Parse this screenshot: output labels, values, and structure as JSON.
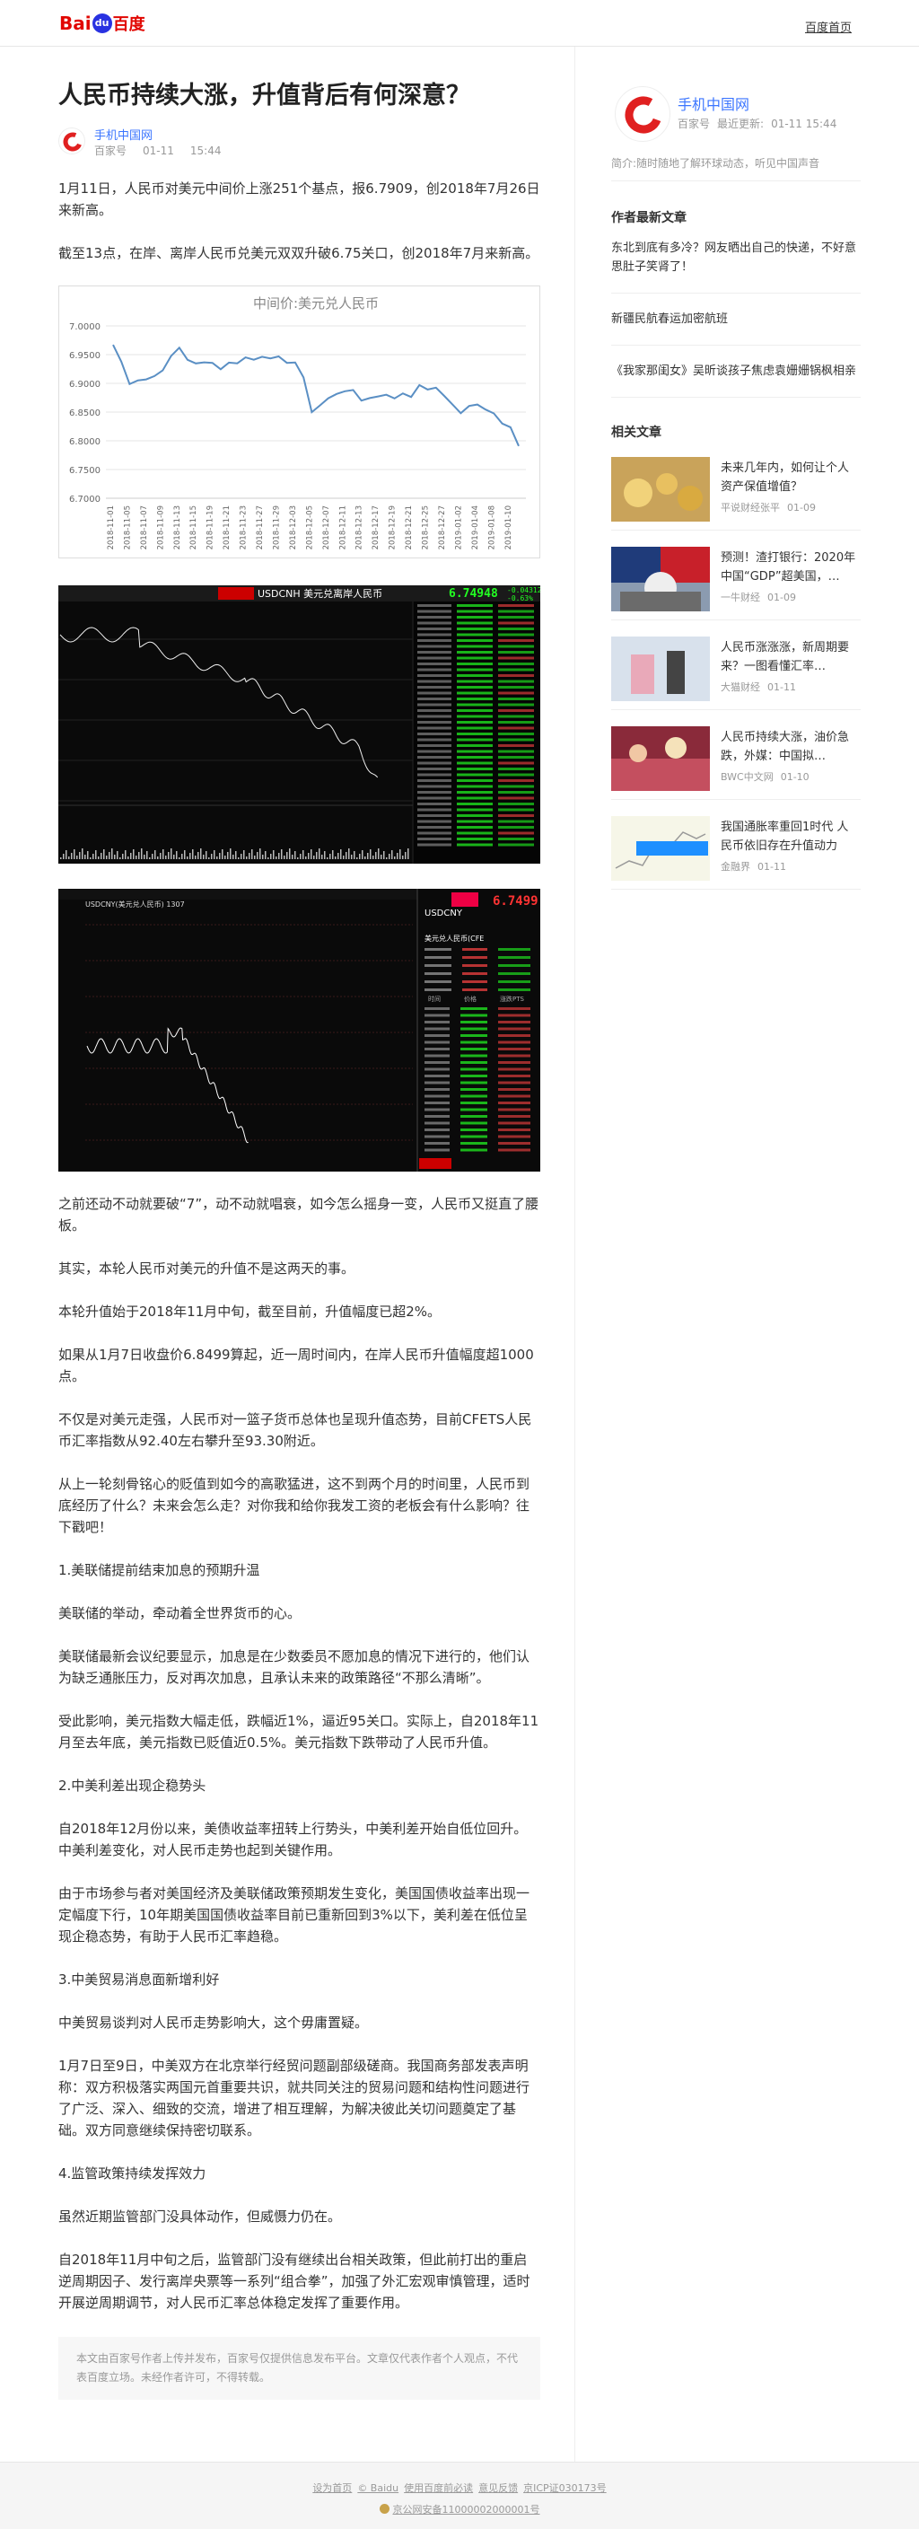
{
  "header": {
    "logo_bai": "Bai",
    "logo_du": "du",
    "logo_cn": "百度",
    "home_link": "百度首页"
  },
  "article": {
    "title": "人民币持续大涨，升值背后有何深意？",
    "author": "手机中国网",
    "source": "百家号",
    "date": "01-11",
    "time": "15:44",
    "paragraphs_top": [
      "1月11日，人民币对美元中间价上涨251个基点，报6.7909，创2018年7月26日来新高。",
      "截至13点，在岸、离岸人民币兑美元双双升破6.75关口，创2018年7月来新高。"
    ],
    "paragraphs_bottom": [
      "之前还动不动就要破“7”，动不动就唱衰，如今怎么摇身一变，人民币又挺直了腰板。",
      "其实，本轮人民币对美元的升值不是这两天的事。",
      "本轮升值始于2018年11月中旬，截至目前，升值幅度已超2%。",
      "如果从1月7日收盘价6.8499算起，近一周时间内，在岸人民币升值幅度超1000点。",
      "不仅是对美元走强，人民币对一篮子货币总体也呈现升值态势，目前CFETS人民币汇率指数从92.40左右攀升至93.30附近。",
      "从上一轮刻骨铭心的贬值到如今的高歌猛进，这不到两个月的时间里，人民币到底经历了什么？未来会怎么走？对你我和给你我发工资的老板会有什么影响？往下戳吧！",
      "1.美联储提前结束加息的预期升温",
      "美联储的举动，牵动着全世界货币的心。",
      "美联储最新会议纪要显示，加息是在少数委员不愿加息的情况下进行的，他们认为缺乏通胀压力，反对再次加息，且承认未来的政策路径“不那么清晰”。",
      "受此影响，美元指数大幅走低，跌幅近1%，逼近95关口。实际上，自2018年11月至去年底，美元指数已贬值近0.5%。美元指数下跌带动了人民币升值。",
      "2.中美利差出现企稳势头",
      "自2018年12月份以来，美债收益率扭转上行势头，中美利差开始自低位回升。中美利差变化，对人民币走势也起到关键作用。",
      "由于市场参与者对美国经济及美联储政策预期发生变化，美国国债收益率出现一定幅度下行，10年期美国国债收益率目前已重新回到3%以下，美利差在低位呈现企稳态势，有助于人民币汇率趋稳。",
      "3.中美贸易消息面新增利好",
      "中美贸易谈判对人民币走势影响大，这个毋庸置疑。",
      "1月7日至9日，中美双方在北京举行经贸问题副部级磋商。我国商务部发表声明称：双方积极落实两国元首重要共识，就共同关注的贸易问题和结构性问题进行了广泛、深入、细致的交流，增进了相互理解，为解决彼此关切问题奠定了基础。双方同意继续保持密切联系。",
      "4.监管政策持续发挥效力",
      "虽然近期监管部门没具体动作，但威慑力仍在。",
      "自2018年11月中旬之后，监管部门没有继续出台相关政策，但此前打出的重启逆周期因子、发行离岸央票等一系列“组合拳”，加强了外汇宏观审慎管理，适时开展逆周期调节，对人民币汇率总体稳定发挥了重要作用。"
    ],
    "notice": "本文由百家号作者上传并发布，百家号仅提供信息发布平台。文章仅代表作者个人观点，不代表百度立场。未经作者许可，不得转载。"
  },
  "chart_data": {
    "type": "line",
    "title": "中间价:美元兑人民币",
    "xlabel": "",
    "ylabel": "",
    "ylim": [
      6.7,
      7.0
    ],
    "yticks": [
      "7.0000",
      "6.9500",
      "6.9000",
      "6.8500",
      "6.8000",
      "6.7500",
      "6.7000"
    ],
    "grid": true,
    "color": "#5a8fc4",
    "x": [
      "2018-11-01",
      "2018-11-02",
      "2018-11-05",
      "2018-11-06",
      "2018-11-07",
      "2018-11-08",
      "2018-11-09",
      "2018-11-12",
      "2018-11-13",
      "2018-11-14",
      "2018-11-15",
      "2018-11-16",
      "2018-11-19",
      "2018-11-20",
      "2018-11-21",
      "2018-11-22",
      "2018-11-23",
      "2018-11-26",
      "2018-11-27",
      "2018-11-28",
      "2018-11-29",
      "2018-11-30",
      "2018-12-03",
      "2018-12-04",
      "2018-12-05",
      "2018-12-06",
      "2018-12-07",
      "2018-12-10",
      "2018-12-11",
      "2018-12-12",
      "2018-12-13",
      "2018-12-14",
      "2018-12-17",
      "2018-12-18",
      "2018-12-19",
      "2018-12-20",
      "2018-12-21",
      "2018-12-24",
      "2018-12-25",
      "2018-12-26",
      "2018-12-27",
      "2018-12-28",
      "2019-01-02",
      "2019-01-03",
      "2019-01-04",
      "2019-01-07",
      "2019-01-08",
      "2019-01-09",
      "2019-01-10",
      "2019-01-11"
    ],
    "x_tick_labels": [
      "2018-11-01",
      "2018-11-05",
      "2018-11-07",
      "2018-11-09",
      "2018-11-13",
      "2018-11-15",
      "2018-11-19",
      "2018-11-21",
      "2018-11-23",
      "2018-11-27",
      "2018-11-29",
      "2018-12-03",
      "2018-12-05",
      "2018-12-07",
      "2018-12-11",
      "2018-12-13",
      "2018-12-17",
      "2018-12-19",
      "2018-12-21",
      "2018-12-25",
      "2018-12-27",
      "2019-01-02",
      "2019-01-04",
      "2019-01-08",
      "2019-01-10"
    ],
    "values": [
      6.967,
      6.9377,
      6.8987,
      6.9052,
      6.9069,
      6.9127,
      6.9225,
      6.9475,
      6.9621,
      6.941,
      6.9347,
      6.9365,
      6.9357,
      6.9246,
      6.9361,
      6.9348,
      6.9451,
      6.9411,
      6.9463,
      6.9435,
      6.9469,
      6.9357,
      6.9362,
      6.9103,
      6.8498,
      6.8617,
      6.8741,
      6.8816,
      6.8862,
      6.8884,
      6.87,
      6.8743,
      6.8772,
      6.8802,
      6.8737,
      6.8825,
      6.8762,
      6.897,
      6.8892,
      6.8925,
      6.8782,
      6.8632,
      6.8482,
      6.8606,
      6.8631,
      6.8544,
      6.8476,
      6.83,
      6.8236,
      6.7909
    ]
  },
  "dark_chart_1": {
    "title": "USDCNH 美元兑离岸人民币",
    "price": "6.74948",
    "change": "-0.04312",
    "pct": "-0.63%"
  },
  "dark_chart_2": {
    "title": "USDCNY(美元兑人民币) 1307",
    "code": "USDCNY",
    "price": "6.7499",
    "label": "美元兑人民币(CFE",
    "table_header": [
      "时间",
      "价格",
      "涨跌PTS"
    ]
  },
  "sidebar": {
    "author": "手机中国网",
    "source": "百家号",
    "updated_label": "最近更新:",
    "updated": "01-11 15:44",
    "desc": "简介:随时随地了解环球动态，听见中国声音",
    "latest_title": "作者最新文章",
    "latest": [
      "东北到底有多冷？网友晒出自己的快递，不好意思肚子笑肾了！",
      "新疆民航春运加密航班",
      "《我家那闺女》吴昕谈孩子焦虑袁姗姗锅枫相亲"
    ],
    "related_title": "相关文章",
    "related": [
      {
        "title": "未来几年内，如何让个人资产保值增值？",
        "source": "平说财经张平",
        "date": "01-09"
      },
      {
        "title": "预测！渣打银行：2020年中国“GDP”超美国，…",
        "source": "一牛财经",
        "date": "01-09"
      },
      {
        "title": "人民币涨涨涨，新周期要来？一图看懂汇率…",
        "source": "大猫财经",
        "date": "01-11"
      },
      {
        "title": "人民币持续大涨，油价急跌，外媒：中国拟…",
        "source": "BWC中文网",
        "date": "01-10"
      },
      {
        "title": "我国通胀率重回1时代 人民币依旧存在升值动力",
        "source": "金融界",
        "date": "01-11"
      }
    ]
  },
  "footer": {
    "links": [
      "设为首页",
      "© Baidu",
      "使用百度前必读",
      "意见反馈",
      "京ICP证030173号"
    ],
    "icp": "京公网安备11000002000001号"
  }
}
